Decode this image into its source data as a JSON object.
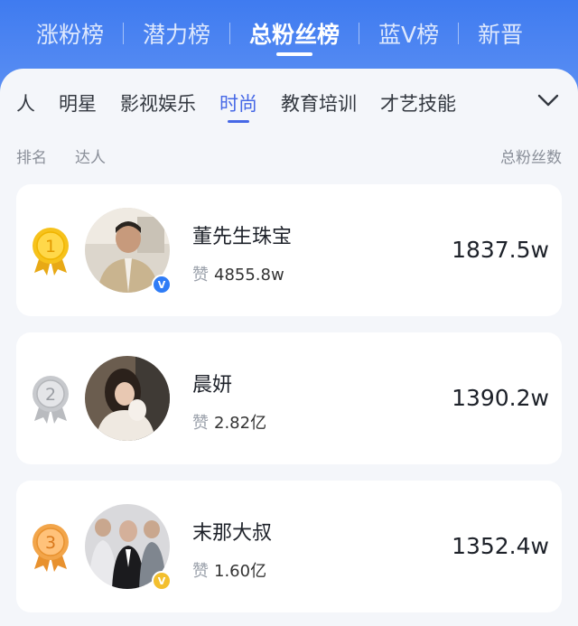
{
  "top_tabs": [
    "涨粉榜",
    "潜力榜",
    "总粉丝榜",
    "蓝V榜",
    "新晋"
  ],
  "categories": [
    "人",
    "明星",
    "影视娱乐",
    "时尚",
    "教育培训",
    "才艺技能"
  ],
  "header": {
    "rank": "排名",
    "talent": "达人",
    "fans": "总粉丝数"
  },
  "likes_label": "赞",
  "rows": [
    {
      "rank": "1",
      "name": "董先生珠宝",
      "likes": "4855.8w",
      "fans": "1837.5w"
    },
    {
      "rank": "2",
      "name": "晨妍",
      "likes": "2.82亿",
      "fans": "1390.2w"
    },
    {
      "rank": "3",
      "name": "末那大叔",
      "likes": "1.60亿",
      "fans": "1352.4w"
    }
  ],
  "colors": {
    "accent": "#4668e6",
    "gold": "#f6c21c",
    "silver": "#c7c9cd",
    "bronze": "#f2a54a",
    "verified_blue": "#2f7cf6",
    "verified_gold": "#f3bf2e"
  }
}
